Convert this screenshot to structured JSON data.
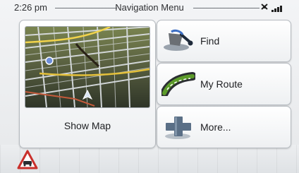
{
  "status": {
    "time": "2:26 pm",
    "title": "Navigation Menu"
  },
  "menu": {
    "map_tile": {
      "label": "Show Map",
      "icon": "map-preview"
    },
    "buttons": [
      {
        "label": "Find",
        "icon": "find-pin-icon"
      },
      {
        "label": "My Route",
        "icon": "route-icon"
      },
      {
        "label": "More...",
        "icon": "plus-icon"
      }
    ]
  },
  "icons": {
    "gps": "gps-satellite-icon",
    "signal": "signal-bars-icon",
    "traffic": "traffic-warning-icon"
  },
  "colors": {
    "accent": "#6aa33c",
    "route_green": "#5c9b2a",
    "plus_blue": "#5a6f86",
    "warning_red": "#c9302c"
  }
}
